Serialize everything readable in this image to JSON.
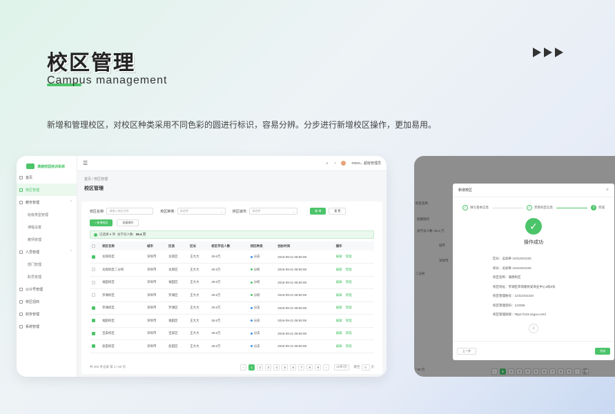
{
  "hero": {
    "title": "校区管理",
    "subtitle": "Campus management",
    "description": "新增和管理校区，对校区种类采用不同色彩的圆进行标识，容易分辨。分步进行新增校区操作，更加易用。"
  },
  "app": {
    "logo_text": "满德校园培训系统",
    "sidebar": [
      {
        "label": "首页",
        "type": "item",
        "icon": "home-icon"
      },
      {
        "label": "校区管理",
        "type": "item",
        "active": true,
        "icon": "building-icon"
      },
      {
        "label": "教务管理",
        "type": "group",
        "icon": "book-icon"
      },
      {
        "label": "班级类型管理",
        "type": "sub"
      },
      {
        "label": "课程设置",
        "type": "sub"
      },
      {
        "label": "教师管理",
        "type": "sub"
      },
      {
        "label": "人员管理",
        "type": "group",
        "icon": "user-icon"
      },
      {
        "label": "部门管理",
        "type": "sub"
      },
      {
        "label": "职员管理",
        "type": "sub"
      },
      {
        "label": "公众号管理",
        "type": "item",
        "icon": "chat-icon"
      },
      {
        "label": "校区招商",
        "type": "item",
        "icon": "flag-icon"
      },
      {
        "label": "财务管理",
        "type": "item",
        "icon": "wallet-icon"
      },
      {
        "label": "系统管理",
        "type": "item",
        "icon": "gear-icon"
      }
    ],
    "user": "mono，超级管理员",
    "breadcrumb": "首页  /  校区管理",
    "page_title": "校区管理",
    "filters": {
      "name_label": "校区名称:",
      "name_placeholder": "请输入校区名称",
      "type_label": "校区种类:",
      "type_placeholder": "请选择",
      "city_label": "校区城市:",
      "city_placeholder": "请选择",
      "search": "查 询",
      "reset": "重 置"
    },
    "actions": {
      "add": "+ 新增校区",
      "batch": "批量操作"
    },
    "alert": {
      "selected": "已选择 6 项",
      "total_label": "总学员人数:",
      "total_value": "26.4 万"
    },
    "table": {
      "headers": [
        "校区名称",
        "城市",
        "区县",
        "区长",
        "校区学员人数",
        "校区种类",
        "创办时间",
        "操作"
      ],
      "rows": [
        {
          "checked": true,
          "name": "龙岗校区",
          "city": "深圳市",
          "district": "龙岗区",
          "head": "王大大",
          "count": "29.6万",
          "type": "分支",
          "type_color": "blue",
          "date": "2016-09-21  08:50:08"
        },
        {
          "checked": false,
          "name": "龙岗校区二分校",
          "city": "深圳市",
          "district": "龙岗区",
          "head": "王大大",
          "count": "29.6万",
          "type": "分校",
          "type_color": "green",
          "date": "2016-09-21  08:50:08"
        },
        {
          "checked": false,
          "name": "福田校区",
          "city": "深圳市",
          "district": "福田区",
          "head": "王大大",
          "count": "29.6万",
          "type": "分校",
          "type_color": "green",
          "date": "2016-09-21  08:50:08"
        },
        {
          "checked": false,
          "name": "罗湖校区",
          "city": "深圳市",
          "district": "罗湖区",
          "head": "王大大",
          "count": "29.6万",
          "type": "分校",
          "type_color": "green",
          "date": "2016-09-21  08:50:08"
        },
        {
          "checked": true,
          "name": "罗湖校区",
          "city": "深圳市",
          "district": "罗湖区",
          "head": "王大大",
          "count": "29.6万",
          "type": "分支",
          "type_color": "blue",
          "date": "2016-09-21  08:50:08"
        },
        {
          "checked": true,
          "name": "福田校区",
          "city": "深圳市",
          "district": "福田区",
          "head": "王大大",
          "count": "29.6万",
          "type": "分支",
          "type_color": "blue",
          "date": "2016-09-21  08:50:08"
        },
        {
          "checked": true,
          "name": "宝安校区",
          "city": "深圳市",
          "district": "宝安区",
          "head": "王大大",
          "count": "29.6万",
          "type": "分支",
          "type_color": "blue",
          "date": "2016-09-21  08:50:08"
        },
        {
          "checked": true,
          "name": "盐田校区",
          "city": "深圳市",
          "district": "盐田区",
          "head": "王大大",
          "count": "29.6万",
          "type": "分支",
          "type_color": "blue",
          "date": "2016-09-21  08:50:08"
        }
      ],
      "op_edit": "编辑",
      "op_manage": "管理"
    },
    "pager": {
      "summary": "共 400 条记录 第 1 / 80 页",
      "pages": [
        "‹",
        "1",
        "2",
        "3",
        "4",
        "5",
        "6",
        "7",
        "8",
        "9",
        "›"
      ],
      "current": "1",
      "page_size": "10条/页",
      "goto_label": "跳至",
      "goto_value": "5",
      "goto_suffix": "页"
    }
  },
  "modal_card": {
    "bg_fragments": [
      "校区名称",
      "批量操作",
      "总学员人数: 26.4 万",
      "城市",
      "深圳市",
      "二分校",
      "/ 80 页"
    ],
    "modal_title": "新增校区",
    "steps": [
      {
        "num": "1",
        "label": "填写基本信息",
        "done": true
      },
      {
        "num": "2",
        "label": "完善校区信息",
        "done": true
      },
      {
        "num": "3",
        "label": "完成",
        "current": true
      }
    ],
    "success_title": "操作成功",
    "details": [
      "区长：吴加奇 12312341234",
      "校长：吴加奇 12312341234",
      "校区名称：满德校区",
      "校区地址：罗湖区笋岗路民安商业中心3栋8号",
      "校区管理账号：12312341234",
      "校区管理密码：123456",
      "校区管理链接：https://123.sogou.com/"
    ],
    "prev": "上一步",
    "finish": "完成",
    "bg_pages": [
      "‹",
      "1",
      "2",
      "3",
      "4",
      "5",
      "6",
      "7",
      "8",
      "9",
      "›",
      "10条/"
    ]
  },
  "colors": {
    "accent": "#4cc46a",
    "branch_dot": "#3a8ee6"
  }
}
